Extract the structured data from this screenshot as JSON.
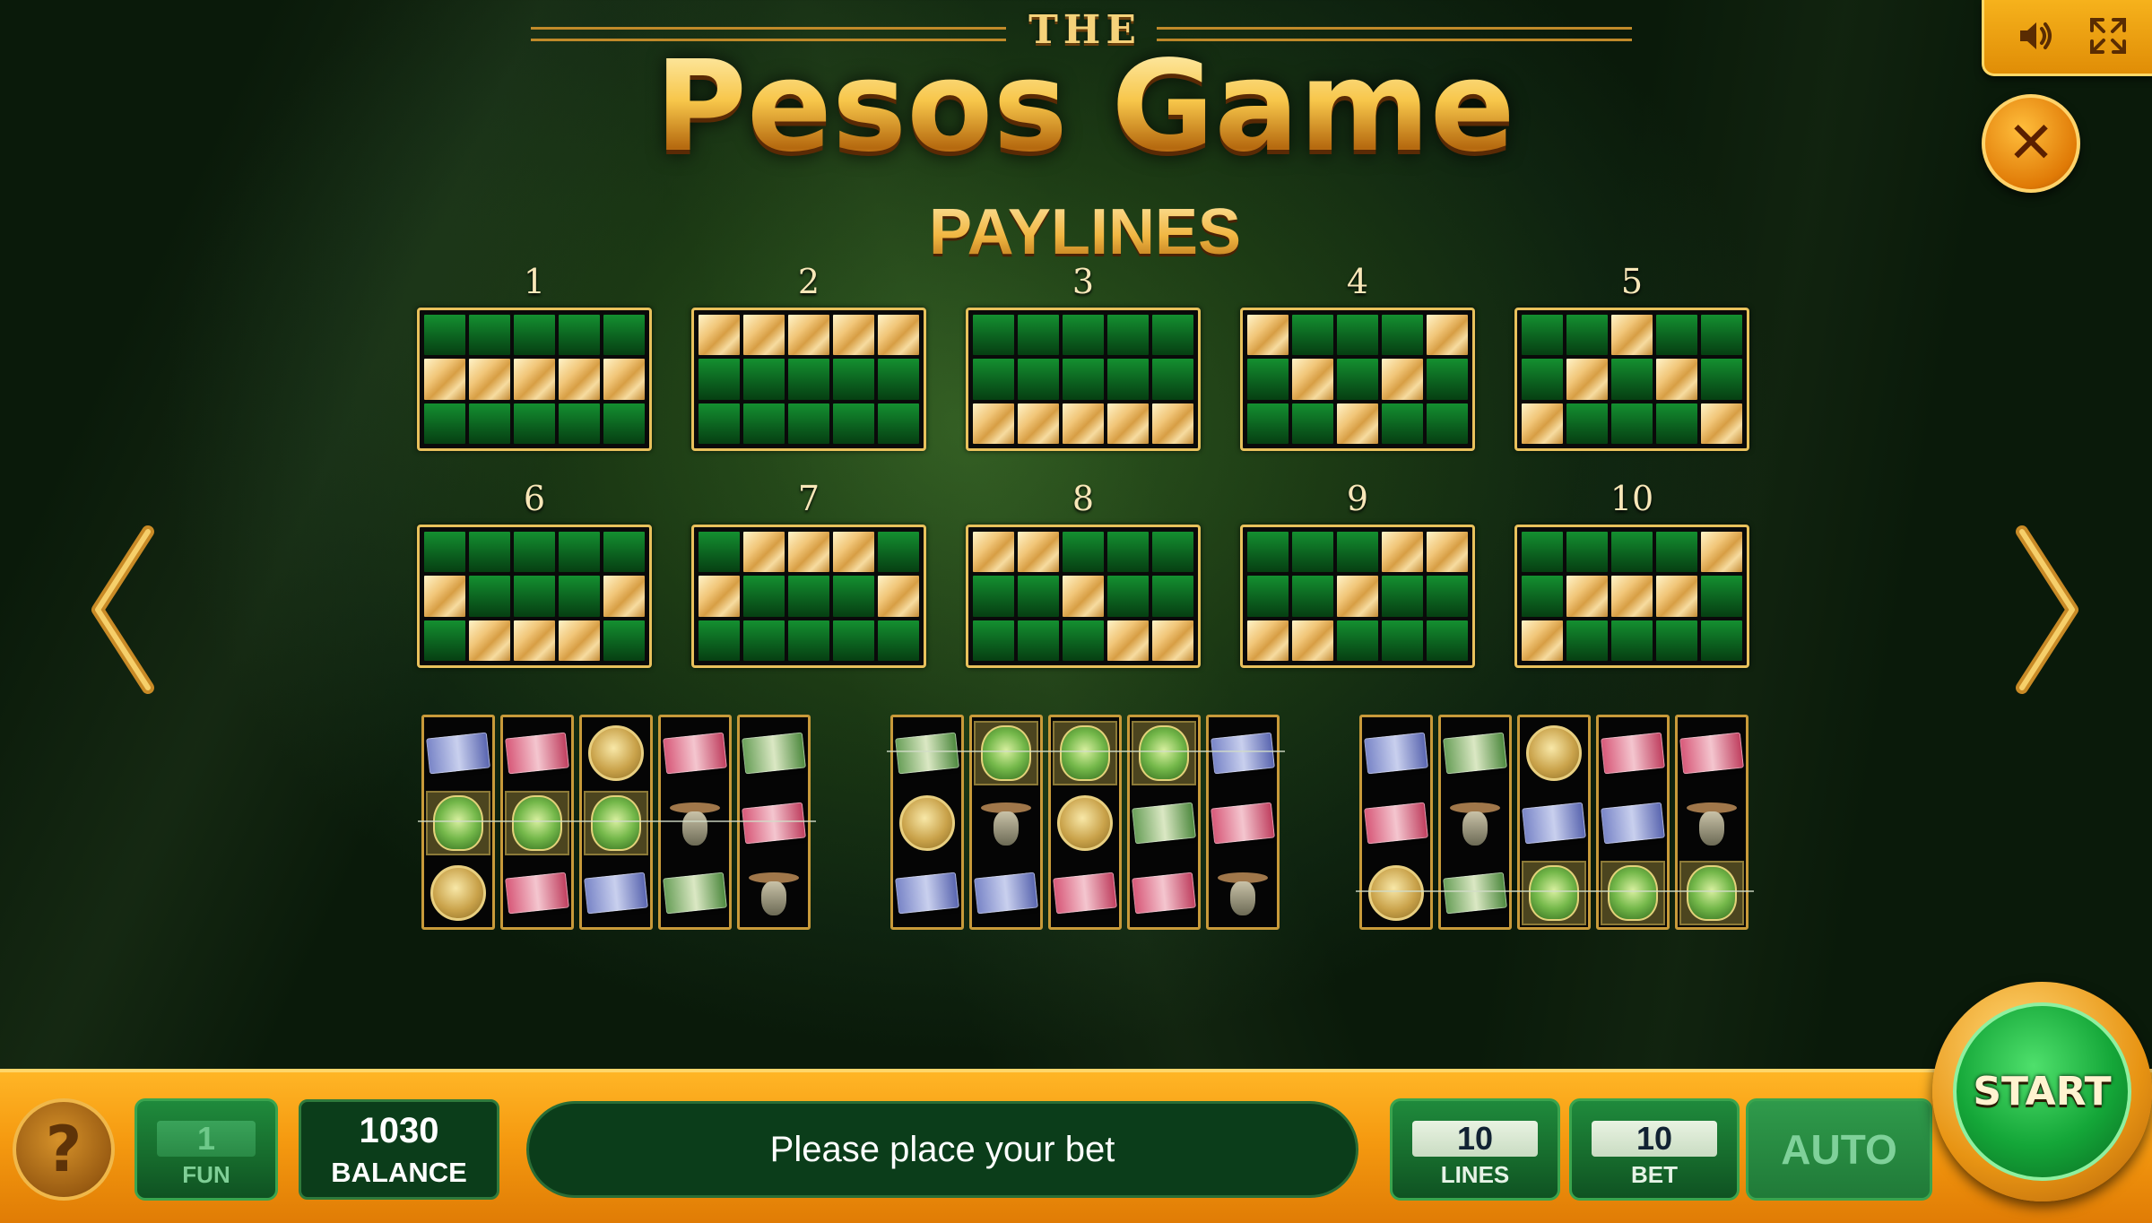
{
  "header": {
    "the_word": "THE",
    "title": "Pesos Game",
    "section": "PAYLINES"
  },
  "controls": {
    "sound_icon": "speaker-icon",
    "fullscreen_icon": "fullscreen-icon",
    "close_icon": "close-icon"
  },
  "paylines": [
    {
      "number": "1",
      "rows": [
        1,
        1,
        1,
        1,
        1
      ]
    },
    {
      "number": "2",
      "rows": [
        0,
        0,
        0,
        0,
        0
      ]
    },
    {
      "number": "3",
      "rows": [
        2,
        2,
        2,
        2,
        2
      ]
    },
    {
      "number": "4",
      "rows": [
        0,
        1,
        2,
        1,
        0
      ]
    },
    {
      "number": "5",
      "rows": [
        2,
        1,
        0,
        1,
        2
      ]
    },
    {
      "number": "6",
      "rows": [
        1,
        2,
        2,
        2,
        1
      ]
    },
    {
      "number": "7",
      "rows": [
        1,
        0,
        0,
        0,
        1
      ]
    },
    {
      "number": "8",
      "rows": [
        0,
        0,
        1,
        2,
        2
      ]
    },
    {
      "number": "9",
      "rows": [
        2,
        2,
        1,
        0,
        0
      ]
    },
    {
      "number": "10",
      "rows": [
        2,
        1,
        1,
        1,
        0
      ]
    }
  ],
  "examples": [
    {
      "reels": [
        [
          "bill-blue",
          "emblem",
          "coin"
        ],
        [
          "bill-red",
          "emblem",
          "bill-red"
        ],
        [
          "coin",
          "emblem",
          "bill-blue"
        ],
        [
          "bill-red",
          "hat",
          "bill-green"
        ],
        [
          "bill-green",
          "bill-red",
          "hat"
        ]
      ],
      "highlight": [
        [
          1,
          0
        ],
        [
          1,
          1
        ],
        [
          1,
          2
        ]
      ]
    },
    {
      "reels": [
        [
          "bill-green",
          "coin",
          "bill-blue"
        ],
        [
          "emblem",
          "hat",
          "bill-blue"
        ],
        [
          "emblem",
          "coin",
          "bill-red"
        ],
        [
          "emblem",
          "bill-green",
          "bill-red"
        ],
        [
          "bill-blue",
          "bill-red",
          "hat"
        ]
      ],
      "highlight": [
        [
          0,
          1
        ],
        [
          0,
          2
        ],
        [
          0,
          3
        ]
      ]
    },
    {
      "reels": [
        [
          "bill-blue",
          "bill-red",
          "coin"
        ],
        [
          "bill-green",
          "hat",
          "bill-green"
        ],
        [
          "coin",
          "bill-blue",
          "emblem"
        ],
        [
          "bill-red",
          "bill-blue",
          "emblem"
        ],
        [
          "bill-red",
          "hat",
          "emblem"
        ]
      ],
      "highlight": [
        [
          2,
          2
        ],
        [
          2,
          3
        ],
        [
          2,
          4
        ]
      ]
    }
  ],
  "bottom_bar": {
    "help_label": "?",
    "fun_value": "1",
    "fun_label": "FUN",
    "balance_value": "1030",
    "balance_label": "BALANCE",
    "message": "Please place your bet",
    "lines_value": "10",
    "lines_label": "LINES",
    "bet_value": "10",
    "bet_label": "BET",
    "auto_label": "AUTO",
    "start_label": "START"
  },
  "colors": {
    "accent_gold": "#f1b93a",
    "bar_orange": "#f59a10",
    "panel_green": "#166a2c",
    "start_green": "#14a638"
  }
}
